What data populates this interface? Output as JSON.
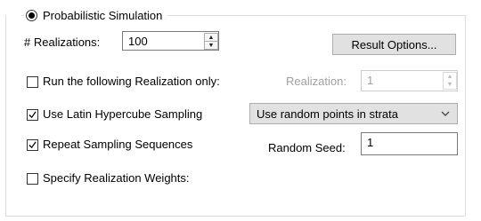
{
  "group": {
    "title": "Probabilistic Simulation",
    "selected": true
  },
  "realizations": {
    "label": "# Realizations:",
    "value": "100"
  },
  "result_options_label": "Result Options...",
  "run_single": {
    "label": "Run the following Realization only:",
    "checked": false,
    "realization_label": "Realization:",
    "realization_value": "1",
    "enabled": false
  },
  "latin_hypercube": {
    "label": "Use Latin Hypercube Sampling",
    "checked": true,
    "mode_selected": "Use random points in strata"
  },
  "repeat_sampling": {
    "label": "Repeat Sampling Sequences",
    "checked": true,
    "seed_label": "Random Seed:",
    "seed_value": "1"
  },
  "weights": {
    "label": "Specify Realization Weights:",
    "checked": false
  },
  "icons": {
    "spin_up": "up-arrow-icon",
    "spin_down": "down-arrow-icon",
    "dropdown": "chevron-down-icon",
    "check": "checkmark-icon"
  }
}
